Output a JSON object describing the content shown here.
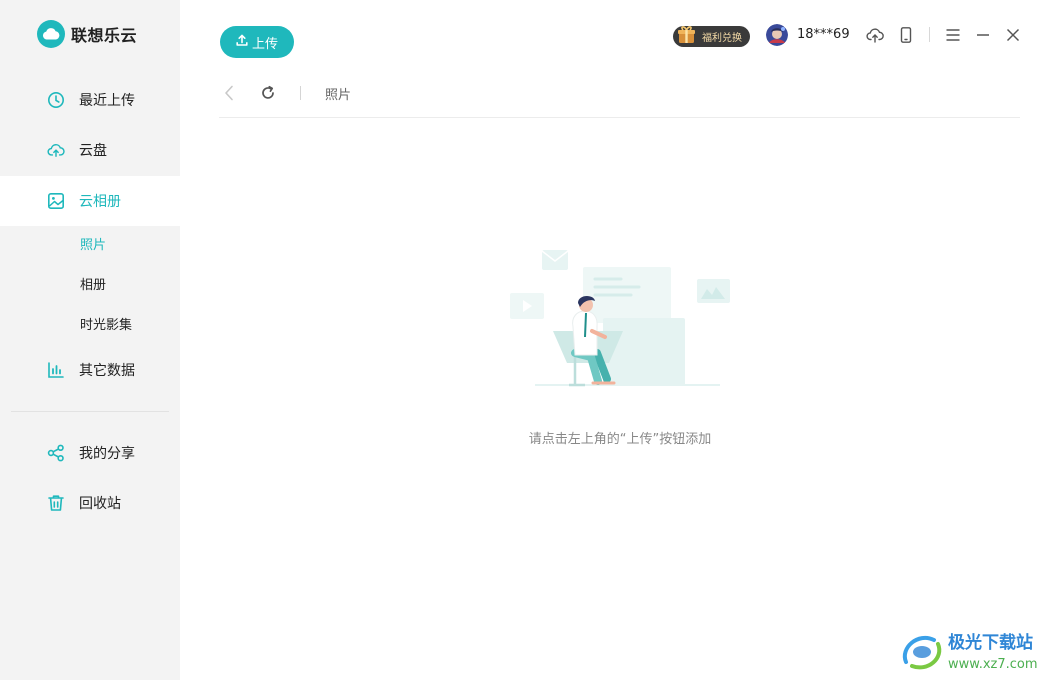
{
  "app": {
    "name": "联想乐云"
  },
  "sidebar": {
    "items": [
      {
        "label": "最近上传",
        "icon": "clock-icon"
      },
      {
        "label": "云盘",
        "icon": "cloud-upload-icon"
      },
      {
        "label": "云相册",
        "icon": "image-icon"
      },
      {
        "label": "其它数据",
        "icon": "bar-chart-icon"
      },
      {
        "label": "我的分享",
        "icon": "share-icon"
      },
      {
        "label": "回收站",
        "icon": "trash-icon"
      }
    ],
    "subitems": [
      {
        "label": "照片"
      },
      {
        "label": "相册"
      },
      {
        "label": "时光影集"
      }
    ]
  },
  "header": {
    "upload_label": "上传",
    "welfare_label": "福利兑换",
    "username": "18***69"
  },
  "toolbar": {
    "breadcrumb": "照片"
  },
  "empty": {
    "message": "请点击左上角的“上传”按钮添加"
  },
  "watermark": {
    "title": "极光下载站",
    "url": "www.xz7.com"
  },
  "colors": {
    "accent": "#1fb8bc",
    "sidebar_bg": "#f3f3f3"
  }
}
